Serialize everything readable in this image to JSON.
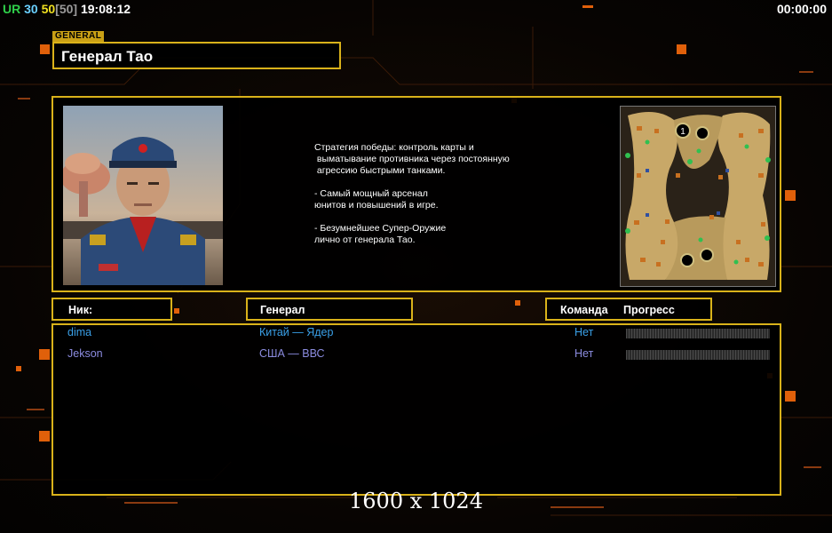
{
  "hud": {
    "tag_ur": "UR",
    "n1": "30",
    "n2": "50",
    "n3": "[50]",
    "clock": "19:08:12",
    "timer": "00:00:00"
  },
  "general_tab": "GENERAL",
  "general_name": "Генерал Тао",
  "description": "Стратегия победы: контроль карты и\n выматывание противника через постоянную\n агрессию быстрыми танками.\n\n- Самый мощный арсенал\nюнитов и повышений в игре.\n\n- Безумнейшее Супер-Оружие\nлично от генерала Тао.",
  "columns": {
    "nick": "Ник:",
    "general": "Генерал",
    "team": "Команда",
    "progress": "Прогресс"
  },
  "players": [
    {
      "nick": "dima",
      "general": "Китай — Ядер",
      "team": "Нет",
      "color": "#3aa0e8"
    },
    {
      "nick": "Jekson",
      "general": "США — ВВС",
      "team": "Нет",
      "color": "#8c8ce0"
    }
  ],
  "minimap_marker": "1",
  "resolution_label": "1600 x 1024",
  "colors": {
    "accent": "#d9b21a",
    "hud_green": "#2fd04a",
    "hud_cyan": "#6ad0ff",
    "hud_yellow": "#f0e020",
    "hud_gray": "#9a9a9a"
  }
}
